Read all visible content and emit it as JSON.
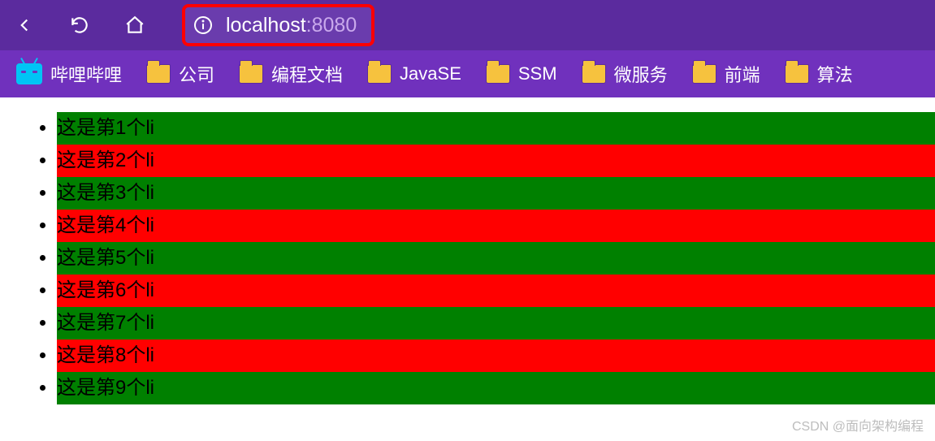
{
  "address": {
    "host": "localhost",
    "port": ":8080"
  },
  "bookmarks": [
    {
      "label": "哔哩哔哩",
      "type": "bili"
    },
    {
      "label": "公司",
      "type": "folder"
    },
    {
      "label": "编程文档",
      "type": "folder"
    },
    {
      "label": "JavaSE",
      "type": "folder"
    },
    {
      "label": "SSM",
      "type": "folder"
    },
    {
      "label": "微服务",
      "type": "folder"
    },
    {
      "label": "前端",
      "type": "folder"
    },
    {
      "label": "算法",
      "type": "folder"
    }
  ],
  "list_items": [
    "这是第1个li",
    "这是第2个li",
    "这是第3个li",
    "这是第4个li",
    "这是第5个li",
    "这是第6个li",
    "这是第7个li",
    "这是第8个li",
    "这是第9个li"
  ],
  "watermark": "CSDN @面向架构编程"
}
